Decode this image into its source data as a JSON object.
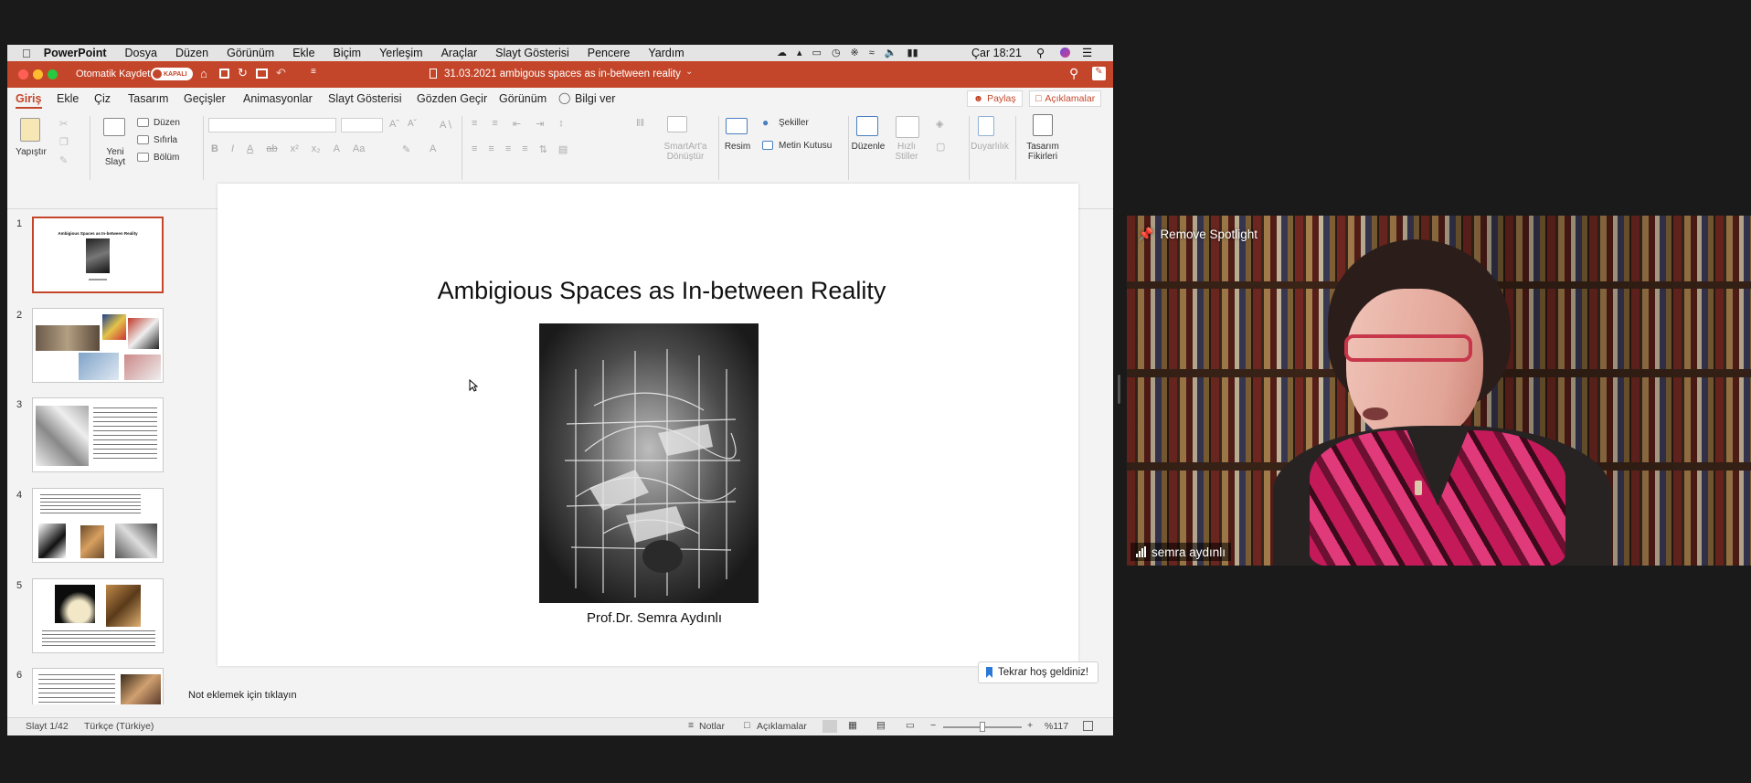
{
  "menubar": {
    "app": "PowerPoint",
    "items": [
      "Dosya",
      "Düzen",
      "Görünüm",
      "Ekle",
      "Biçim",
      "Yerleşim",
      "Araçlar",
      "Slayt Gösterisi",
      "Pencere",
      "Yardım"
    ],
    "clock": "Çar 18:21"
  },
  "titlebar": {
    "autosave_label": "Otomatik Kaydet",
    "autosave_state": "KAPALI",
    "doc_title": "31.03.2021 ambigous spaces as in-between reality"
  },
  "tabs": {
    "items": [
      "Giriş",
      "Ekle",
      "Çiz",
      "Tasarım",
      "Geçişler",
      "Animasyonlar",
      "Slayt Gösterisi",
      "Gözden Geçir",
      "Görünüm"
    ],
    "tell_me": "Bilgi ver",
    "share": "Paylaş",
    "comments": "Açıklamalar"
  },
  "ribbon": {
    "paste": "Yapıştır",
    "new_slide": "Yeni Slayt",
    "layout": "Düzen",
    "reset": "Sıfırla",
    "section": "Bölüm",
    "smartart": "SmartArt'a Dönüştür",
    "picture": "Resim",
    "shapes": "Şekiller",
    "textbox": "Metin Kutusu",
    "arrange": "Düzenle",
    "quick_styles": "Hızlı Stiller",
    "sensitivity": "Duyarlılık",
    "design_ideas": "Tasarım Fikirleri"
  },
  "thumbnails": {
    "numbers": [
      "1",
      "2",
      "3",
      "4",
      "5",
      "6"
    ],
    "slide1_title": "Ambigious Spaces as In-between Reality"
  },
  "slide": {
    "title": "Ambigious Spaces as In-between Reality",
    "subtitle": "Prof.Dr. Semra Aydınlı"
  },
  "notes": {
    "placeholder": "Not eklemek için tıklayın",
    "welcome_pill": "Tekrar hoş geldiniz!"
  },
  "status": {
    "slide_of": "Slayt 1/42",
    "language": "Türkçe (Türkiye)",
    "notes": "Notlar",
    "comments": "Açıklamalar",
    "zoom": "%117"
  },
  "video": {
    "spotlight": "Remove Spotlight",
    "participant": "semra aydınlı"
  },
  "colors": {
    "accent": "#c4462a",
    "slide_bg": "#ffffff"
  }
}
